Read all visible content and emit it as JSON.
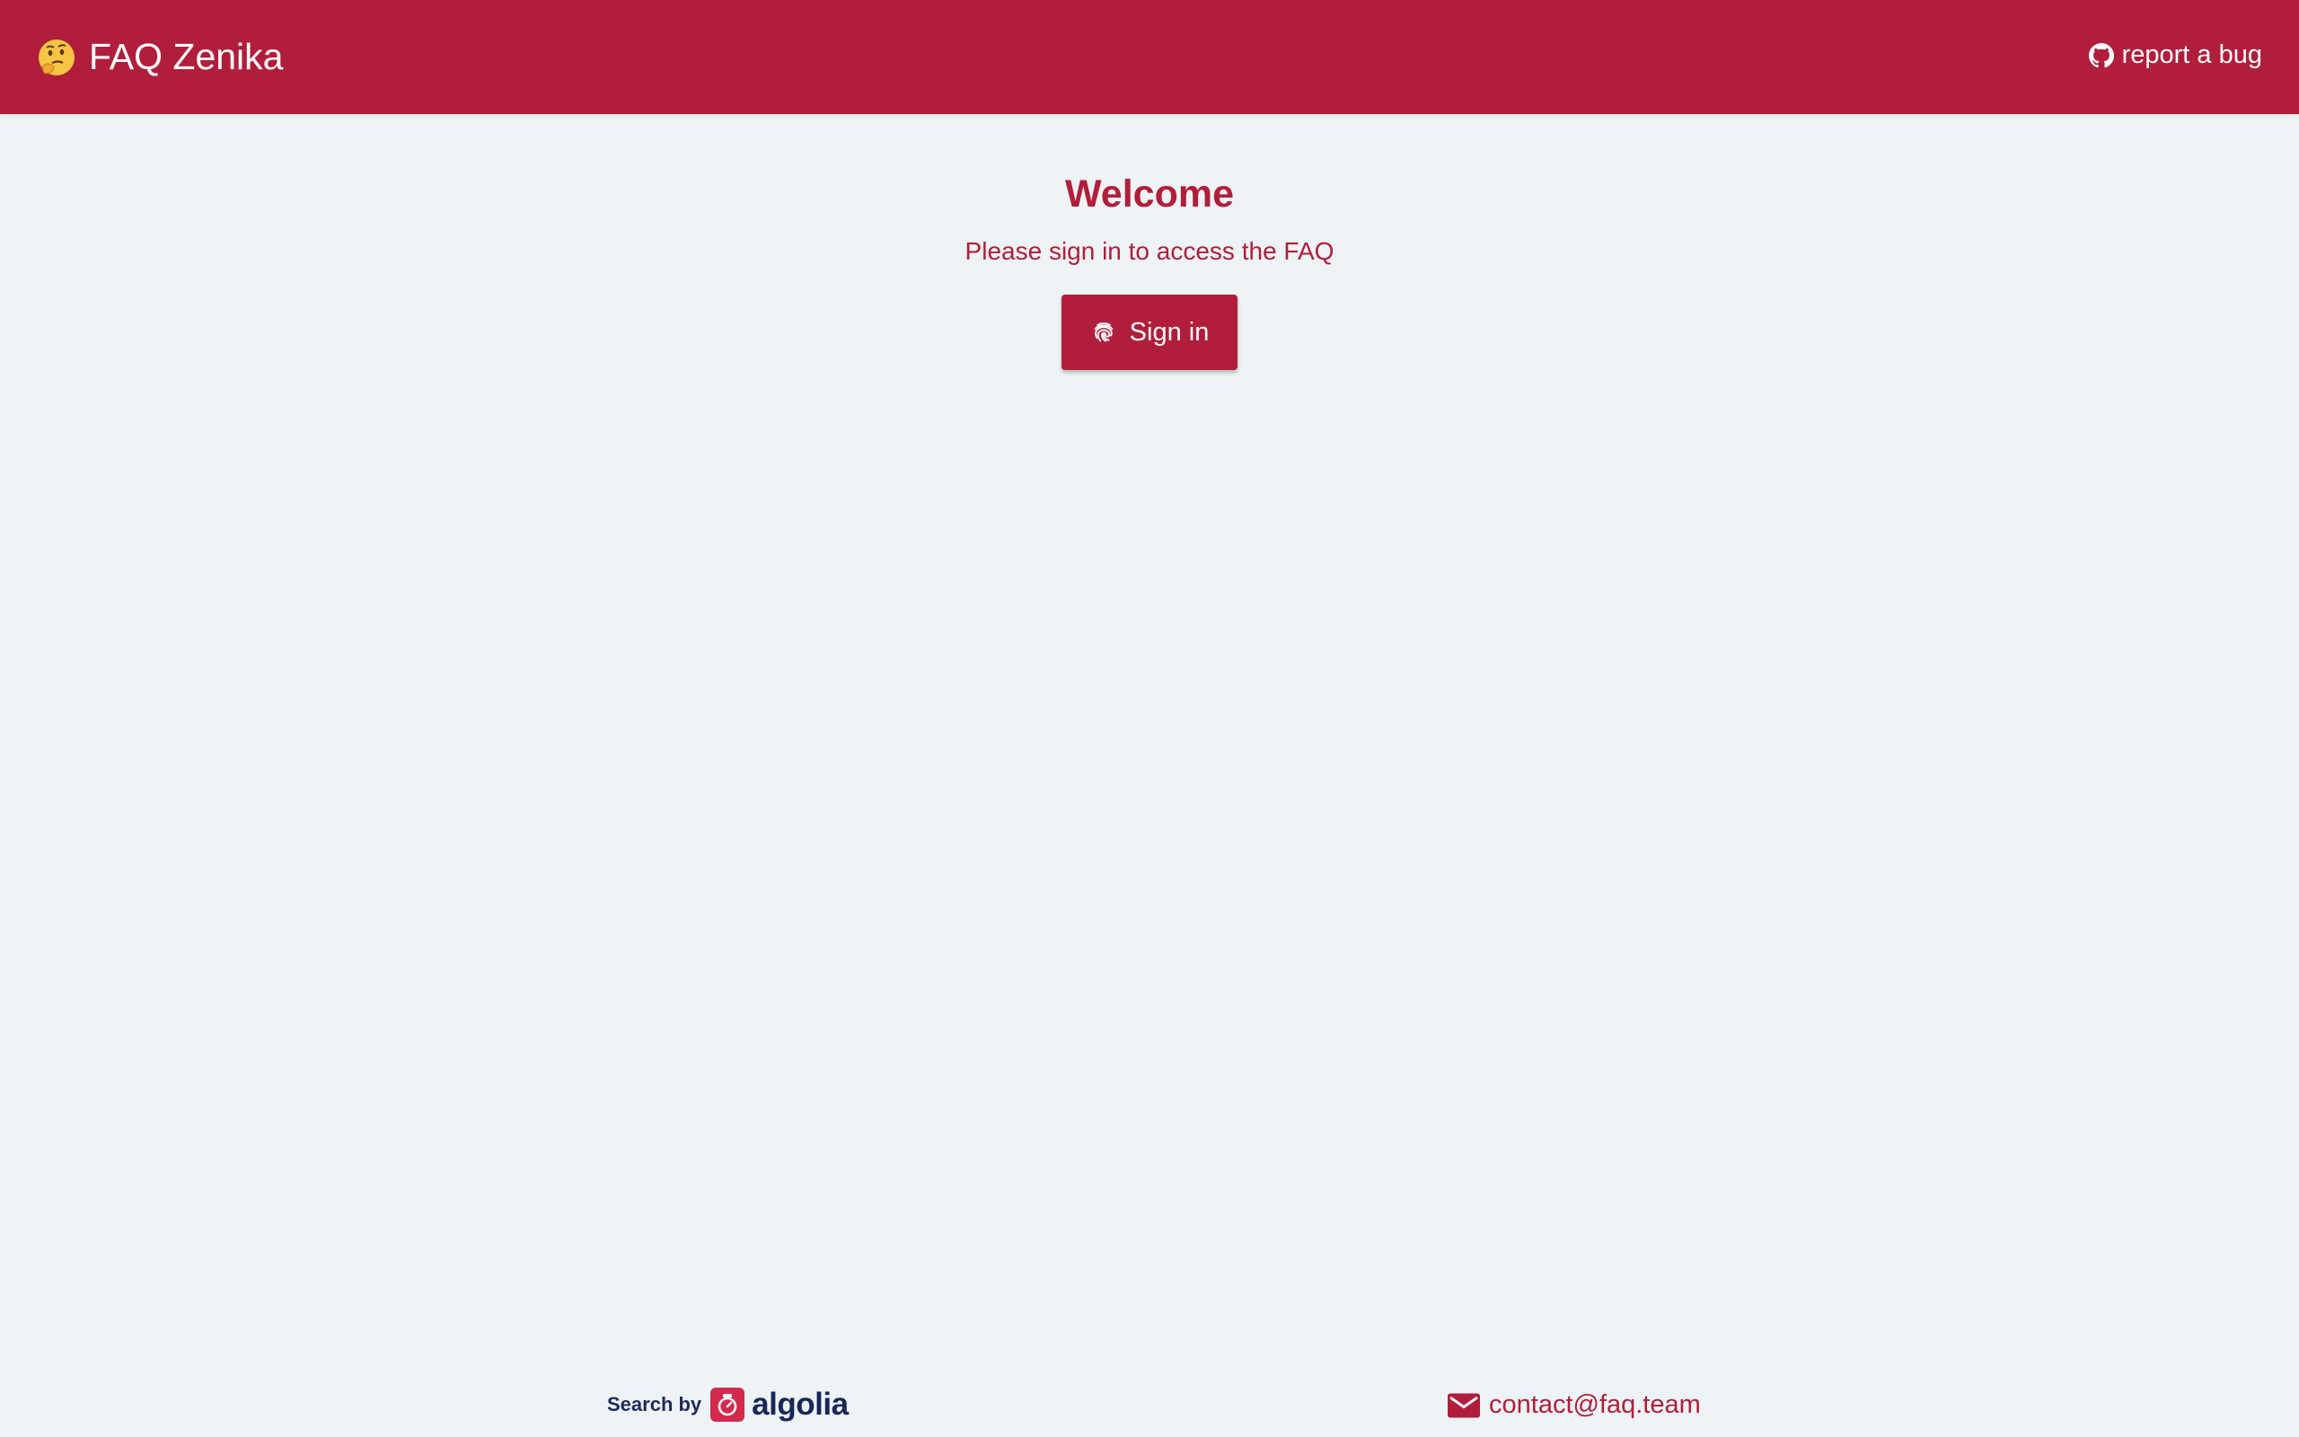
{
  "colors": {
    "brand": "#b01e3b",
    "background": "#eef3f5",
    "algolia_navy": "#182659"
  },
  "header": {
    "emoji_icon": "thinking-face-icon",
    "title": "FAQ Zenika",
    "bug_icon": "github-icon",
    "bug_label": "report a bug"
  },
  "main": {
    "heading": "Welcome",
    "subtitle": "Please sign in to access the FAQ",
    "signin_icon": "fingerprint-icon",
    "signin_label": "Sign in"
  },
  "footer": {
    "search_by": "Search by",
    "algolia_icon": "algolia-icon",
    "algolia": "algolia",
    "mail_icon": "mail-icon",
    "contact": "contact@faq.team"
  }
}
